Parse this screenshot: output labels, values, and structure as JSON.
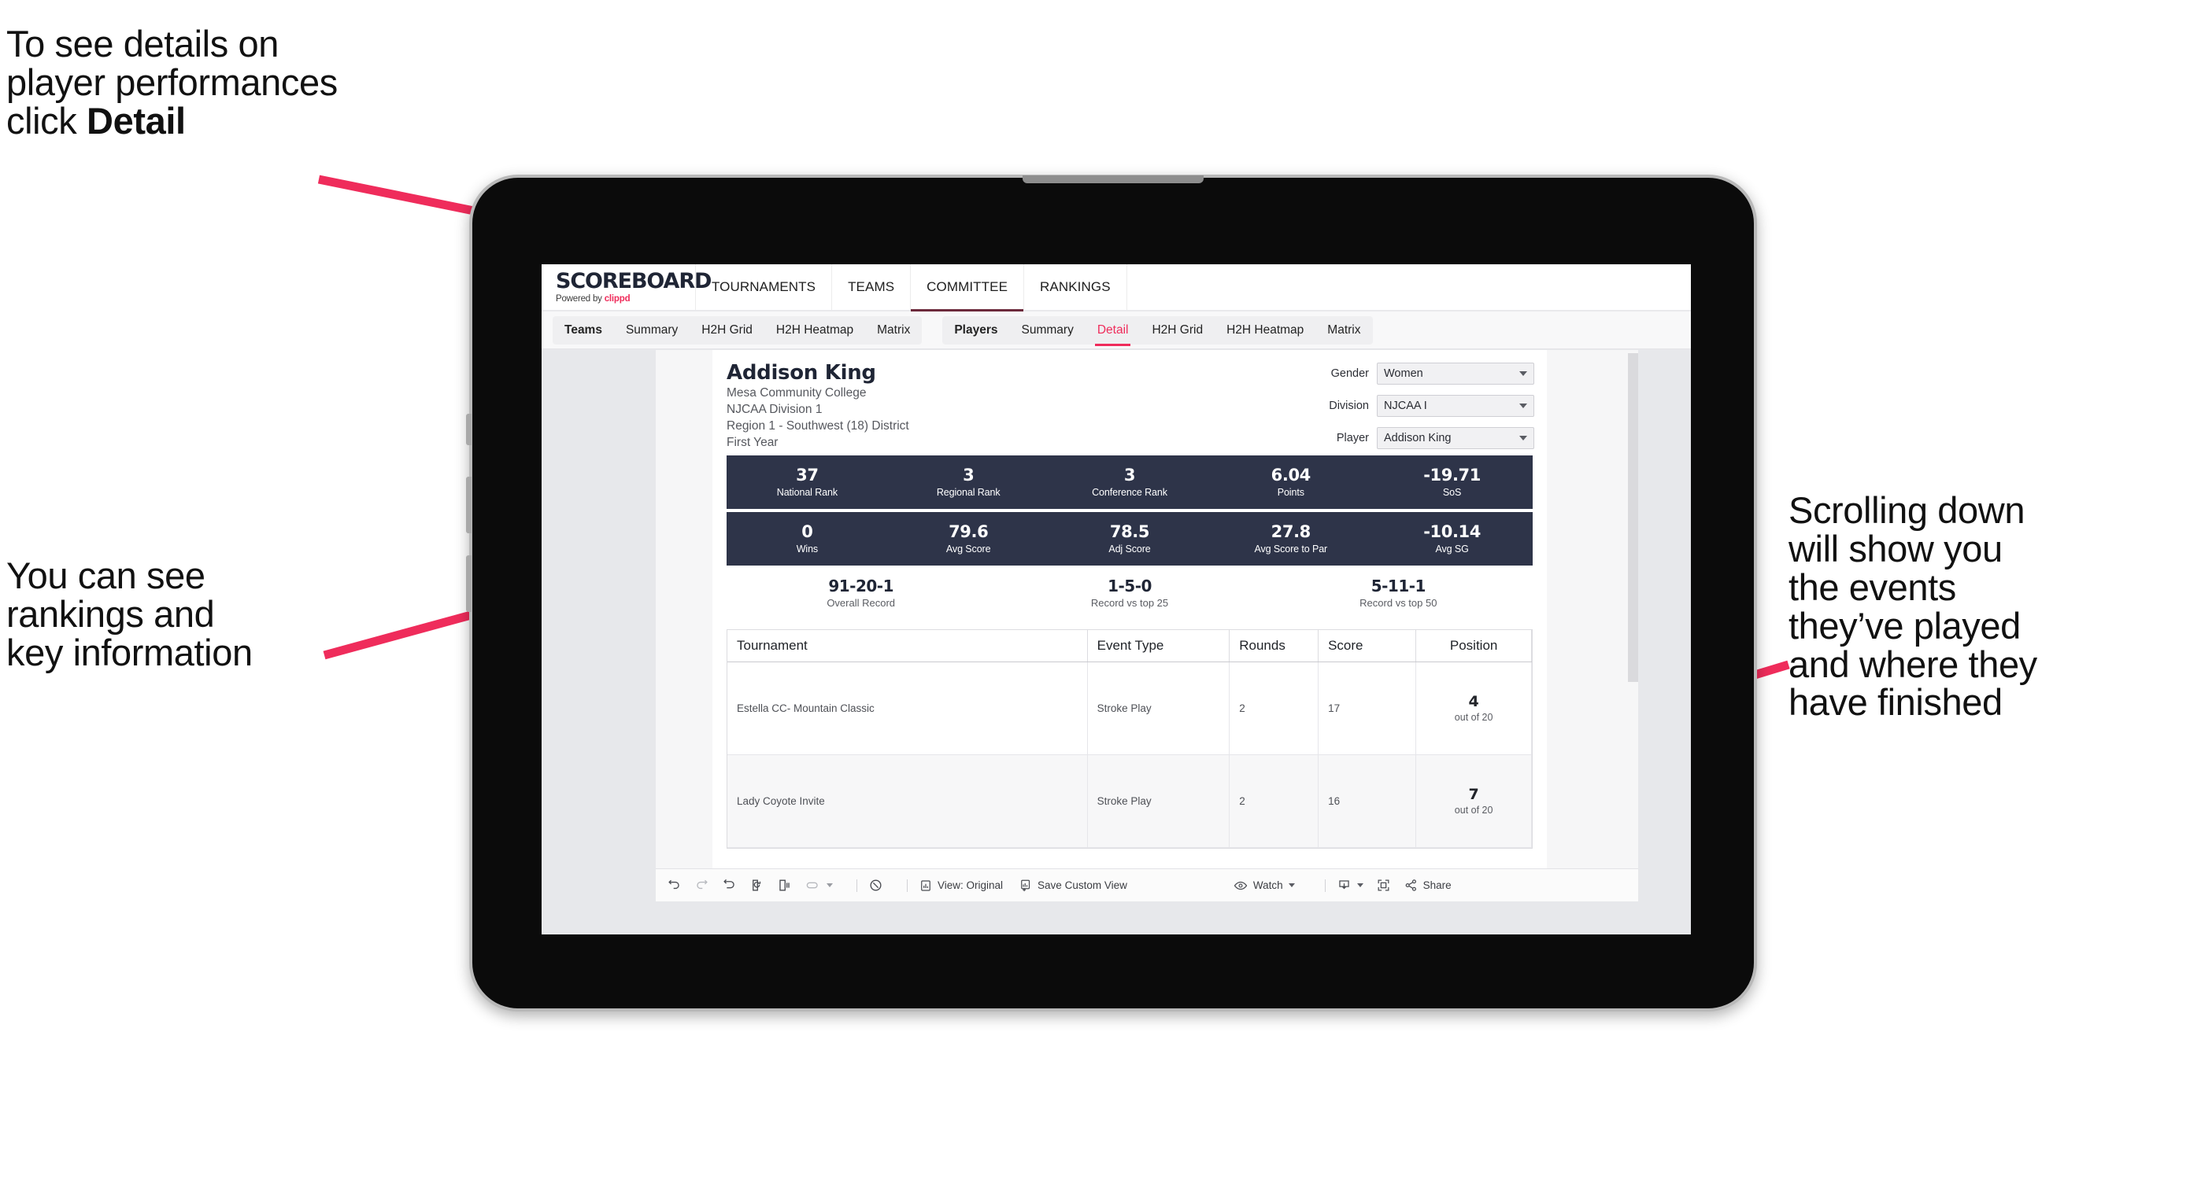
{
  "annotations": {
    "detail": "To see details on\nplayer performances\nclick ",
    "detail_bold": "Detail",
    "rankings": "You can see\nrankings and\nkey information",
    "scrolling": "Scrolling down\nwill show you\nthe events\nthey’ve played\nand where they\nhave finished"
  },
  "colors": {
    "accent_pink": "#ef2c5b",
    "stat_navy": "#2e3449",
    "app_bg": "#e7e8eb"
  },
  "app": {
    "brand": {
      "title": "SCOREBOARD",
      "sub_prefix": "Powered by ",
      "sub_brand": "clippd"
    },
    "topnav": [
      {
        "label": "TOURNAMENTS",
        "active": false
      },
      {
        "label": "TEAMS",
        "active": false
      },
      {
        "label": "COMMITTEE",
        "active": true
      },
      {
        "label": "RANKINGS",
        "active": false
      }
    ],
    "tabs_teams": [
      {
        "label": "Teams",
        "lead": true
      },
      {
        "label": "Summary"
      },
      {
        "label": "H2H Grid"
      },
      {
        "label": "H2H Heatmap"
      },
      {
        "label": "Matrix"
      }
    ],
    "tabs_players": [
      {
        "label": "Players",
        "lead": true
      },
      {
        "label": "Summary"
      },
      {
        "label": "Detail",
        "selected": true
      },
      {
        "label": "H2H Grid"
      },
      {
        "label": "H2H Heatmap"
      },
      {
        "label": "Matrix"
      }
    ]
  },
  "player": {
    "name": "Addison King",
    "school": "Mesa Community College",
    "division": "NJCAA Division 1",
    "region": "Region 1 - Southwest (18) District",
    "year": "First Year"
  },
  "filters": [
    {
      "label": "Gender",
      "value": "Women"
    },
    {
      "label": "Division",
      "value": "NJCAA I"
    },
    {
      "label": "Player",
      "value": "Addison King"
    }
  ],
  "stats_row1": [
    {
      "value": "37",
      "label": "National Rank"
    },
    {
      "value": "3",
      "label": "Regional Rank"
    },
    {
      "value": "3",
      "label": "Conference Rank"
    },
    {
      "value": "6.04",
      "label": "Points"
    },
    {
      "value": "-19.71",
      "label": "SoS"
    }
  ],
  "stats_row2": [
    {
      "value": "0",
      "label": "Wins"
    },
    {
      "value": "79.6",
      "label": "Avg Score"
    },
    {
      "value": "78.5",
      "label": "Adj Score"
    },
    {
      "value": "27.8",
      "label": "Avg Score to Par"
    },
    {
      "value": "-10.14",
      "label": "Avg SG"
    }
  ],
  "records": [
    {
      "value": "91-20-1",
      "label": "Overall Record"
    },
    {
      "value": "1-5-0",
      "label": "Record vs top 25"
    },
    {
      "value": "5-11-1",
      "label": "Record vs top 50"
    }
  ],
  "table": {
    "headers": [
      "Tournament",
      "Event Type",
      "Rounds",
      "Score",
      "Position"
    ],
    "rows": [
      {
        "tournament": "Estella CC- Mountain Classic",
        "event_type": "Stroke Play",
        "rounds": "2",
        "score": "17",
        "pos_num": "4",
        "pos_out": "out of 20"
      },
      {
        "tournament": "Lady Coyote Invite",
        "event_type": "Stroke Play",
        "rounds": "2",
        "score": "16",
        "pos_num": "7",
        "pos_out": "out of 20"
      }
    ]
  },
  "toolbar": {
    "view": "View: Original",
    "save_custom_view": "Save Custom View",
    "watch": "Watch",
    "share": "Share"
  }
}
